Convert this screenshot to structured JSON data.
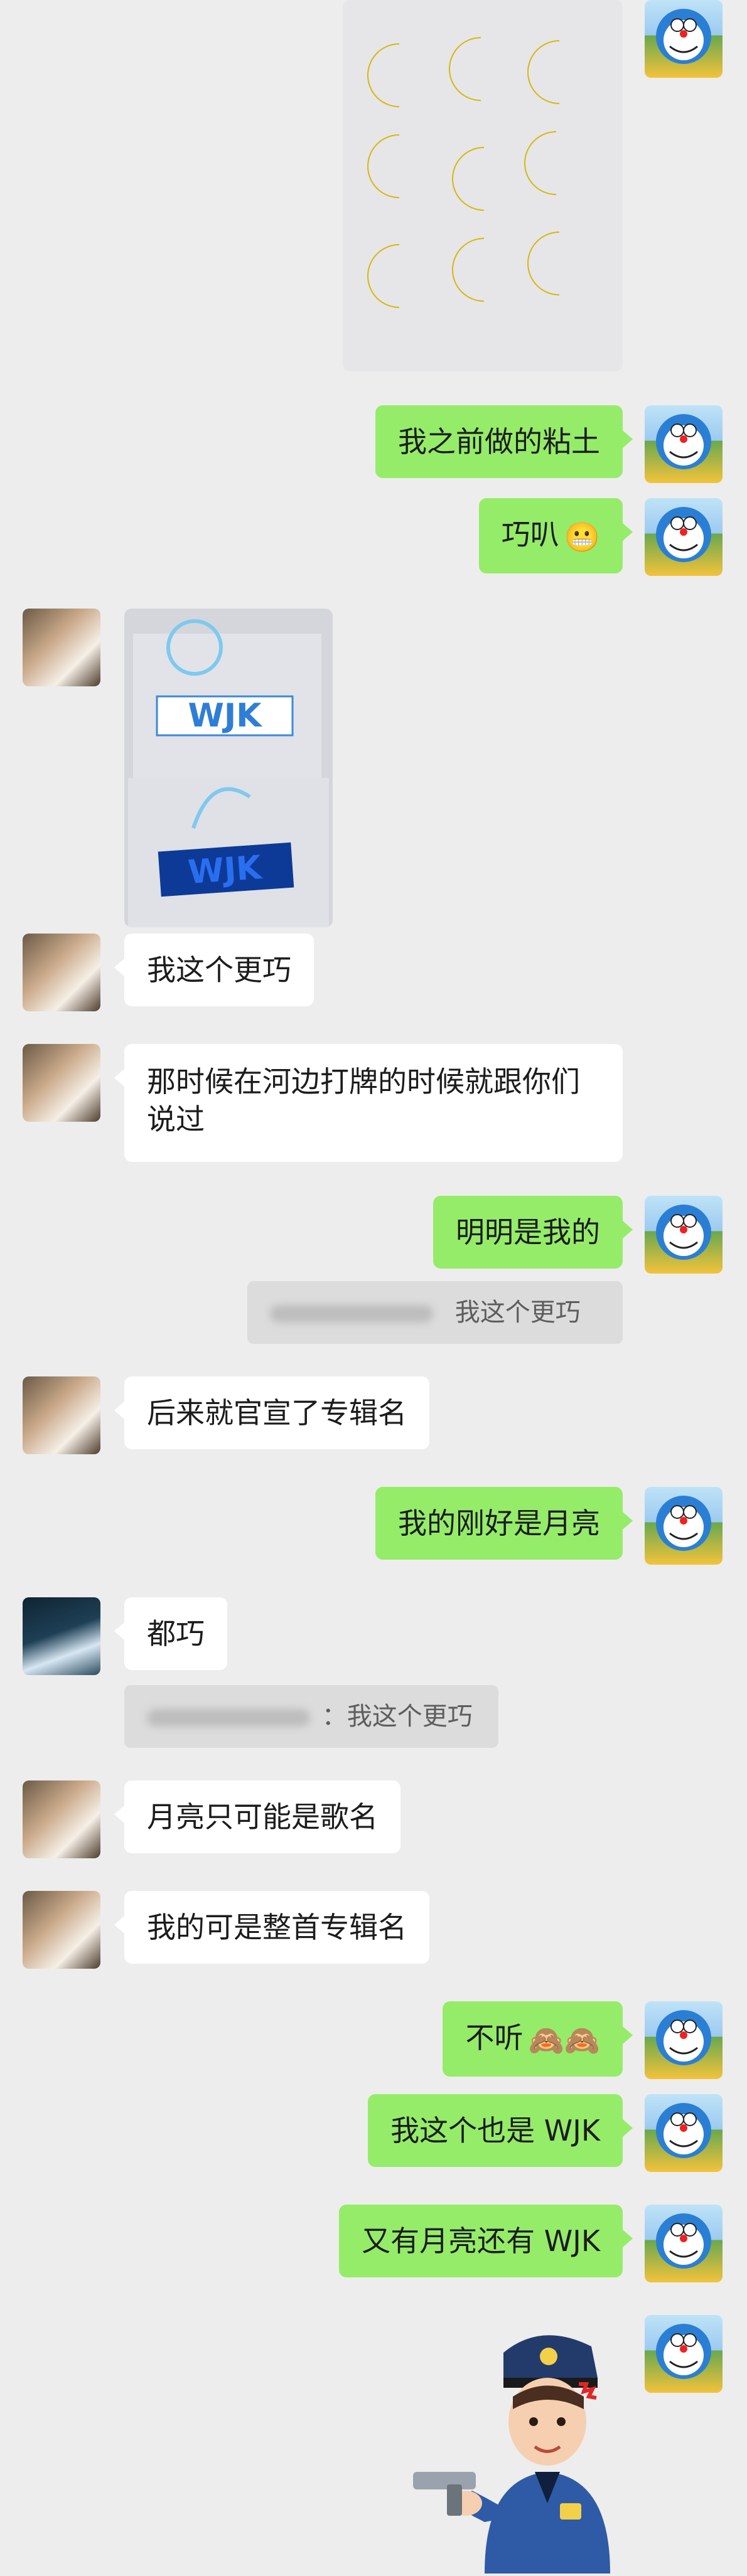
{
  "messages": {
    "m1_text": "我之前做的粘土",
    "m2_text": "巧叭",
    "m2_emoji": "😬",
    "m3_text": "我这个更巧",
    "m4_text": "那时候在河边打牌的时候就跟你们说过",
    "m5_text": "明明是我的",
    "m5_quote_text": "我这个更巧",
    "m6_text": "后来就官宣了专辑名",
    "m7_text": "我的刚好是月亮",
    "m8_text": "都巧",
    "m8_quote_text": "：我这个更巧",
    "m9_text": "月亮只可能是歌名",
    "m10_text": "我的可是整首专辑名",
    "m11_text": "不听",
    "m11_emoji": "🙈🙈",
    "m12_text": "我这个也是 WJK",
    "m13_text": "又有月亮还有 WJK"
  },
  "images": {
    "keychain_text": "WJK",
    "clay_letters": [
      "W",
      "J",
      "K"
    ]
  },
  "colors": {
    "background": "#ededed",
    "bubble_self": "#95ec69",
    "bubble_other": "#ffffff",
    "quote_bg": "#dcdcdc"
  },
  "icons": {
    "right_avatar": "doraemon-avatar",
    "left_avatar_a": "friend-avatar",
    "left_avatar_b": "friend-avatar-dark",
    "sticker": "police-cartoon-sticker"
  }
}
